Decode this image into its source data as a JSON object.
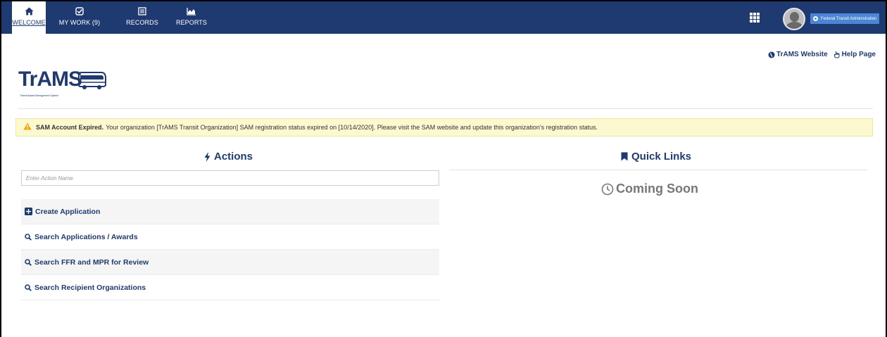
{
  "nav": {
    "tabs": [
      {
        "label": "WELCOME",
        "icon": "home-icon",
        "active": true
      },
      {
        "label": "MY WORK (9)",
        "icon": "checkbox-icon",
        "active": false
      },
      {
        "label": "RECORDS",
        "icon": "records-icon",
        "active": false
      },
      {
        "label": "REPORTS",
        "icon": "reports-chart-icon",
        "active": false
      }
    ],
    "apps_icon": "apps-grid-icon",
    "avatar_icon": "user-avatar-icon",
    "org_button_label": "Federal Transit Administration"
  },
  "colors": {
    "nav_bg": "#1f3a70",
    "brand_text": "#1f3a70",
    "alert_bg": "#fcf8cf",
    "warning": "#f0a500",
    "org_button": "#4b86d4"
  },
  "logo": {
    "text": "TrAMS",
    "tagline": "Transit Award Management System"
  },
  "header_links": {
    "website": "TrAMS Website",
    "help": "Help Page"
  },
  "alert": {
    "title": "SAM Account Expired.",
    "message": "Your organization [TrAMS Transit Organization] SAM registration status expired on [10/14/2020]. Please visit the SAM website and update this organization's registration status."
  },
  "actions": {
    "title": "Actions",
    "search_placeholder": "Enter Action Name",
    "items": [
      {
        "label": "Create Application",
        "icon": "plus-square-icon"
      },
      {
        "label": "Search Applications  / Awards",
        "icon": "search-icon"
      },
      {
        "label": "Search FFR and MPR for Review",
        "icon": "search-icon"
      },
      {
        "label": "Search Recipient Organizations",
        "icon": "search-icon"
      }
    ]
  },
  "quick_links": {
    "title": "Quick Links",
    "coming_soon": "Coming Soon"
  }
}
